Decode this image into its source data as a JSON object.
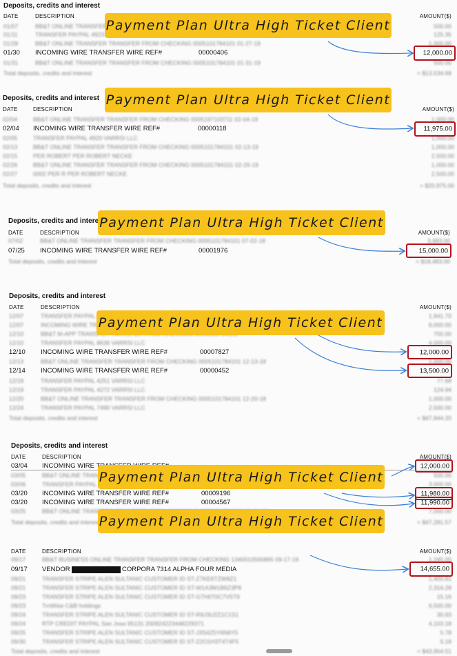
{
  "section_title": "Deposits, credits and interest",
  "col_date": "DATE",
  "col_desc": "DESCRIPTION",
  "col_amount": "AMOUNT($)",
  "banner_text": "Payment Plan Ultra High Ticket Client",
  "blocks": [
    {
      "rows": [
        {
          "date": "01/07",
          "desc": "BB&T ONLINE TRANSFER TRANSFER FROM CHECKING 0005101784101 01-07-19",
          "amount": "500.00",
          "blur": true
        },
        {
          "date": "01/11",
          "desc": "TRANSFER PAYPAL 4923 VARRSI LLC",
          "amount": "125.35",
          "blur": true
        },
        {
          "date": "01/28",
          "desc": "BB&T ONLINE TRANSFER TRANSFER FROM CHECKING 0005101784101 01-27-19",
          "amount": "1,000.00",
          "blur": true
        },
        {
          "date": "01/30",
          "desc": "INCOMING WIRE TRANSFER WIRE REF#",
          "ref": "00000406",
          "amount": "12,000.00",
          "blur": false
        },
        {
          "date": "01/31",
          "desc": "BB&T ONLINE TRANSFER TRANSFER FROM CHECKING 0005101784101 01-31-19",
          "amount": "500.00",
          "blur": true
        }
      ],
      "total_label": "Total deposits, credits and interest",
      "total": "= $13,534.69"
    },
    {
      "rows": [
        {
          "date": "02/04",
          "desc": "BB&T ONLINE TRANSFER TRANSFER FROM CHECKING 0005197103711 02-04-19",
          "amount": "1,000.00",
          "blur": true
        },
        {
          "date": "02/04",
          "desc": "INCOMING WIRE TRANSFER WIRE REF#",
          "ref": "00000118",
          "amount": "11,975.00",
          "blur": false
        },
        {
          "date": "02/05",
          "desc": "TRANSFER PAYPAL 4920 VARRSI LLC",
          "amount": "1,000.00",
          "blur": true
        },
        {
          "date": "02/13",
          "desc": "BB&T ONLINE TRANSFER TRANSFER FROM CHECKING 0005101784101 02-13-19",
          "amount": "1,000.00",
          "blur": true
        },
        {
          "date": "02/15",
          "desc": "PER ROBERT PER ROBERT NECKE",
          "amount": "2,500.00",
          "blur": true
        },
        {
          "date": "02/26",
          "desc": "BB&T ONLINE TRANSFER TRANSFER FROM CHECKING 0005101784101 02-26-19",
          "amount": "1,000.00",
          "blur": true
        },
        {
          "date": "02/27",
          "desc": "0002 PER R PER ROBERT NECKE",
          "amount": "2,500.00",
          "blur": true
        }
      ],
      "total_label": "Total deposits, credits and interest",
      "total": "= $20,975.00"
    },
    {
      "rows": [
        {
          "date": "07/02",
          "desc": "BB&T ONLINE TRANSFER TRANSFER FROM CHECKING 0005101784101 07-02-18",
          "amount": "3,483.00",
          "blur": true
        },
        {
          "date": "07/25",
          "desc": "INCOMING WIRE TRANSFER WIRE REF#",
          "ref": "00001976",
          "amount": "15,000.00",
          "blur": false
        }
      ],
      "total_label": "Total deposits, credits and interest",
      "total": "= $18,483.00"
    },
    {
      "rows": [
        {
          "date": "12/07",
          "desc": "TRANSFER PAYPAL 4920 VARRSI LLC",
          "amount": "1,941.70",
          "blur": true
        },
        {
          "date": "12/07",
          "desc": "INCOMING WIRE TRANSFER WIRE REF#",
          "amount": "8,000.00",
          "blur": true
        },
        {
          "date": "12/10",
          "desc": "BB&T M-APP TRANSFER TRANSFER FROM CHECKING 0005101784101",
          "amount": "700.00",
          "blur": true
        },
        {
          "date": "12/10",
          "desc": "TRANSFER PAYPAL 8636 VARRSI LLC",
          "amount": "4,000.00",
          "blur": true
        },
        {
          "date": "12/10",
          "desc": "INCOMING WIRE TRANSFER WIRE REF#",
          "ref": "00007827",
          "amount": "12,000.00",
          "blur": false
        },
        {
          "date": "12/13",
          "desc": "BB&T ONLINE TRANSFER TRANSFER FROM CHECKING 0005101784101 12-13-18",
          "amount": "1,000.00",
          "blur": true
        },
        {
          "date": "12/14",
          "desc": "INCOMING WIRE TRANSFER WIRE REF#",
          "ref": "00000452",
          "amount": "13,500.00",
          "blur": false
        },
        {
          "date": "12/19",
          "desc": "TRANSFER PAYPAL 4251 VARRSI LLC",
          "amount": "77.68",
          "blur": true
        },
        {
          "date": "12/19",
          "desc": "TRANSFER PAYPAL 4272 VARRSI LLC",
          "amount": "124.94",
          "blur": true
        },
        {
          "date": "12/20",
          "desc": "BB&T ONLINE TRANSFER TRANSFER FROM CHECKING 0005101784101 12-20-18",
          "amount": "1,000.00",
          "blur": true
        },
        {
          "date": "12/24",
          "desc": "TRANSFER PAYPAL 7490 VARRSI LLC",
          "amount": "2,500.00",
          "blur": true
        }
      ],
      "total_label": "Total deposits, credits and interest",
      "total": "= $47,844.20"
    },
    {
      "rows": [
        {
          "date": "03/04",
          "desc": "INCOMING WIRE TRANSFER WIRE REF#",
          "ref": "00005341",
          "amount": "12,000.00",
          "blur": false
        },
        {
          "date": "03/05",
          "desc": "BB&T ONLINE TRANSFER TRANSFER FROM CHECKING 0005101784101",
          "amount": "500.00",
          "blur": true
        },
        {
          "date": "03/06",
          "desc": "TRANSFER PAYPAL 4920 VARRSI LLC",
          "amount": "3,000.00",
          "blur": true
        },
        {
          "date": "03/20",
          "desc": "INCOMING WIRE TRANSFER WIRE REF#",
          "ref": "00009196",
          "amount": "11,980.00",
          "blur": false
        },
        {
          "date": "03/20",
          "desc": "INCOMING WIRE TRANSFER WIRE REF#",
          "ref": "00004567",
          "amount": "11,990.00",
          "blur": false
        },
        {
          "date": "03/25",
          "desc": "BB&T ONLINE TRANSFER TRANSFER FROM CHECKING 0005101784101 03-24-19",
          "amount": "7,000.00",
          "blur": true
        }
      ],
      "total_label": "Total deposits, credits and interest",
      "total": "= $47,281.57"
    },
    {
      "rows": [
        {
          "date": "09/17",
          "desc": "BB&T BUSINESS ONLINE TRANSFER TRANSFER FROM CHECKING 1340010565865 09-17-19",
          "amount": "1,245.00",
          "blur": true
        },
        {
          "date": "09/17",
          "desc": "VENDOR",
          "desc2": "CORPORA 7314 ALPHA FOUR MEDIA",
          "amount": "14,655.00",
          "blur": false
        },
        {
          "date": "09/21",
          "desc": "TRANSFER STRIPE ALEN SULTANIC CUSTOMER ID ST-Z7KE6TZW8Z1",
          "amount": "1,400.81",
          "blur": true
        },
        {
          "date": "09/21",
          "desc": "TRANSFER STRIPE ALEN SULTANIC CUSTOMER ID ST-W1A3M1B6Z3P8",
          "amount": "2,316.28",
          "blur": true
        },
        {
          "date": "09/23",
          "desc": "TRANSFER STRIPE ALEN SULTANIC CUSTOMER ID ST-G7H6T0C7V5T9",
          "amount": "15.16",
          "blur": true
        },
        {
          "date": "09/23",
          "desc": "TrnWise C&B holdings",
          "amount": "6,500.00",
          "blur": true
        },
        {
          "date": "09/24",
          "desc": "TRANSFER STRIPE ALEN SULTANIC CUSTOMER ID ST-R9J3U2Z1C1S1",
          "amount": "30.93",
          "blur": true
        },
        {
          "date": "09/24",
          "desc": "RTP CREDIT PAYPAL San Jose 95131 200924223448229371",
          "amount": "4,103.18",
          "blur": true
        },
        {
          "date": "09/25",
          "desc": "TRANSFER STRIPE ALEN SULTANIC CUSTOMER ID ST-J3S4Z5Y6N6Y5",
          "amount": "5.78",
          "blur": true
        },
        {
          "date": "09/30",
          "desc": "TRANSFER STRIPE ALEN SULTANIC CUSTOMER ID ST-Z2O1H3T4T4F5",
          "amount": "5.18",
          "blur": true
        }
      ],
      "total_label": "Total deposits, credits and interest",
      "total": "= $43,954.51"
    }
  ],
  "highlight_color": "#b3121a",
  "banner_color": "#f6c21b",
  "arrow_color": "#3b7fd8"
}
